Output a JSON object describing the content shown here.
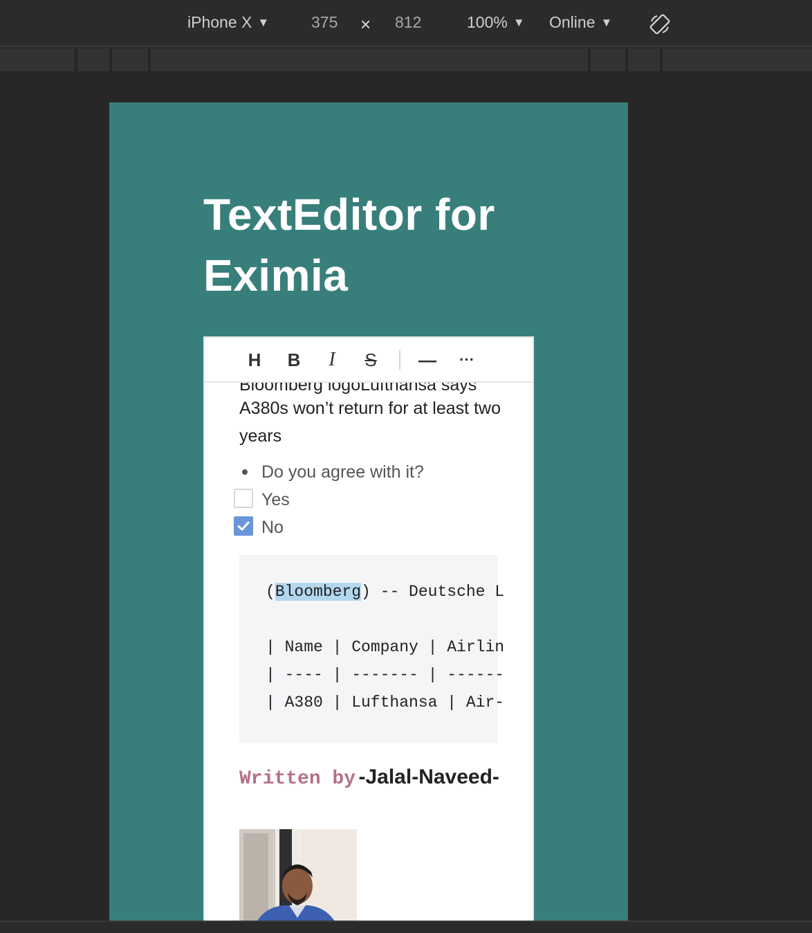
{
  "devtools": {
    "device": "iPhone X",
    "width": "375",
    "times": "×",
    "height": "812",
    "zoom": "100%",
    "network": "Online",
    "rotate_icon": "rotate-icon"
  },
  "page": {
    "title": "TextEditor for Eximia"
  },
  "toolbar": {
    "heading": "H",
    "bold": "B",
    "italic": "I",
    "strike": "S",
    "hr": "—",
    "more": "···"
  },
  "content": {
    "cut_line": "Bloomberg logoLufthansa says",
    "paragraph": "A380s won’t return for at least two years",
    "bullet": "Do you agree with it?",
    "tasks": [
      {
        "label": "Yes",
        "checked": false
      },
      {
        "label": "No",
        "checked": true
      }
    ],
    "code": {
      "open_paren": "(",
      "selected": "Bloomberg",
      "rest": ") -- Deutsche L",
      "table_header": "| Name | Company | Airlin",
      "table_divider": "| ---- | ------- | ------",
      "table_row": "| A380 | Lufthansa | Air-"
    },
    "written_by": "Written by",
    "author": "-Jalal-Naveed-"
  }
}
